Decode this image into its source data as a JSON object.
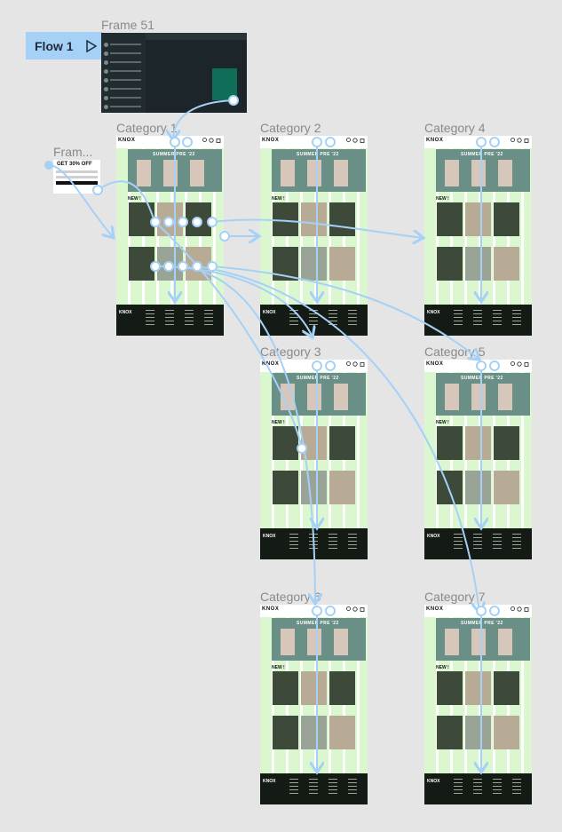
{
  "flow": {
    "label": "Flow 1",
    "icon": "play-icon"
  },
  "frames": [
    {
      "id": "frame51",
      "label": "Frame 51"
    },
    {
      "id": "popup",
      "label": "Fram..."
    },
    {
      "id": "cat1",
      "label": "Category 1"
    },
    {
      "id": "cat2",
      "label": "Category 2"
    },
    {
      "id": "cat3",
      "label": "Category 3"
    },
    {
      "id": "cat4",
      "label": "Category 4"
    },
    {
      "id": "cat5",
      "label": "Category 5"
    },
    {
      "id": "cat6",
      "label": "Category 6"
    },
    {
      "id": "cat7",
      "label": "Category 7"
    }
  ],
  "site": {
    "logo": "KNOX",
    "hero_title": "SUMMER PRE '22",
    "new_label": "NEW !",
    "footer_logo": "KNOX",
    "icons": [
      "search-icon",
      "heart-icon",
      "bag-icon"
    ]
  },
  "popup": {
    "headline": "GET 30% OFF"
  },
  "colors": {
    "canvas": "#e5e5e5",
    "connector": "#a6d1f7",
    "grid": "#bef0aa",
    "footer": "#141a14"
  }
}
